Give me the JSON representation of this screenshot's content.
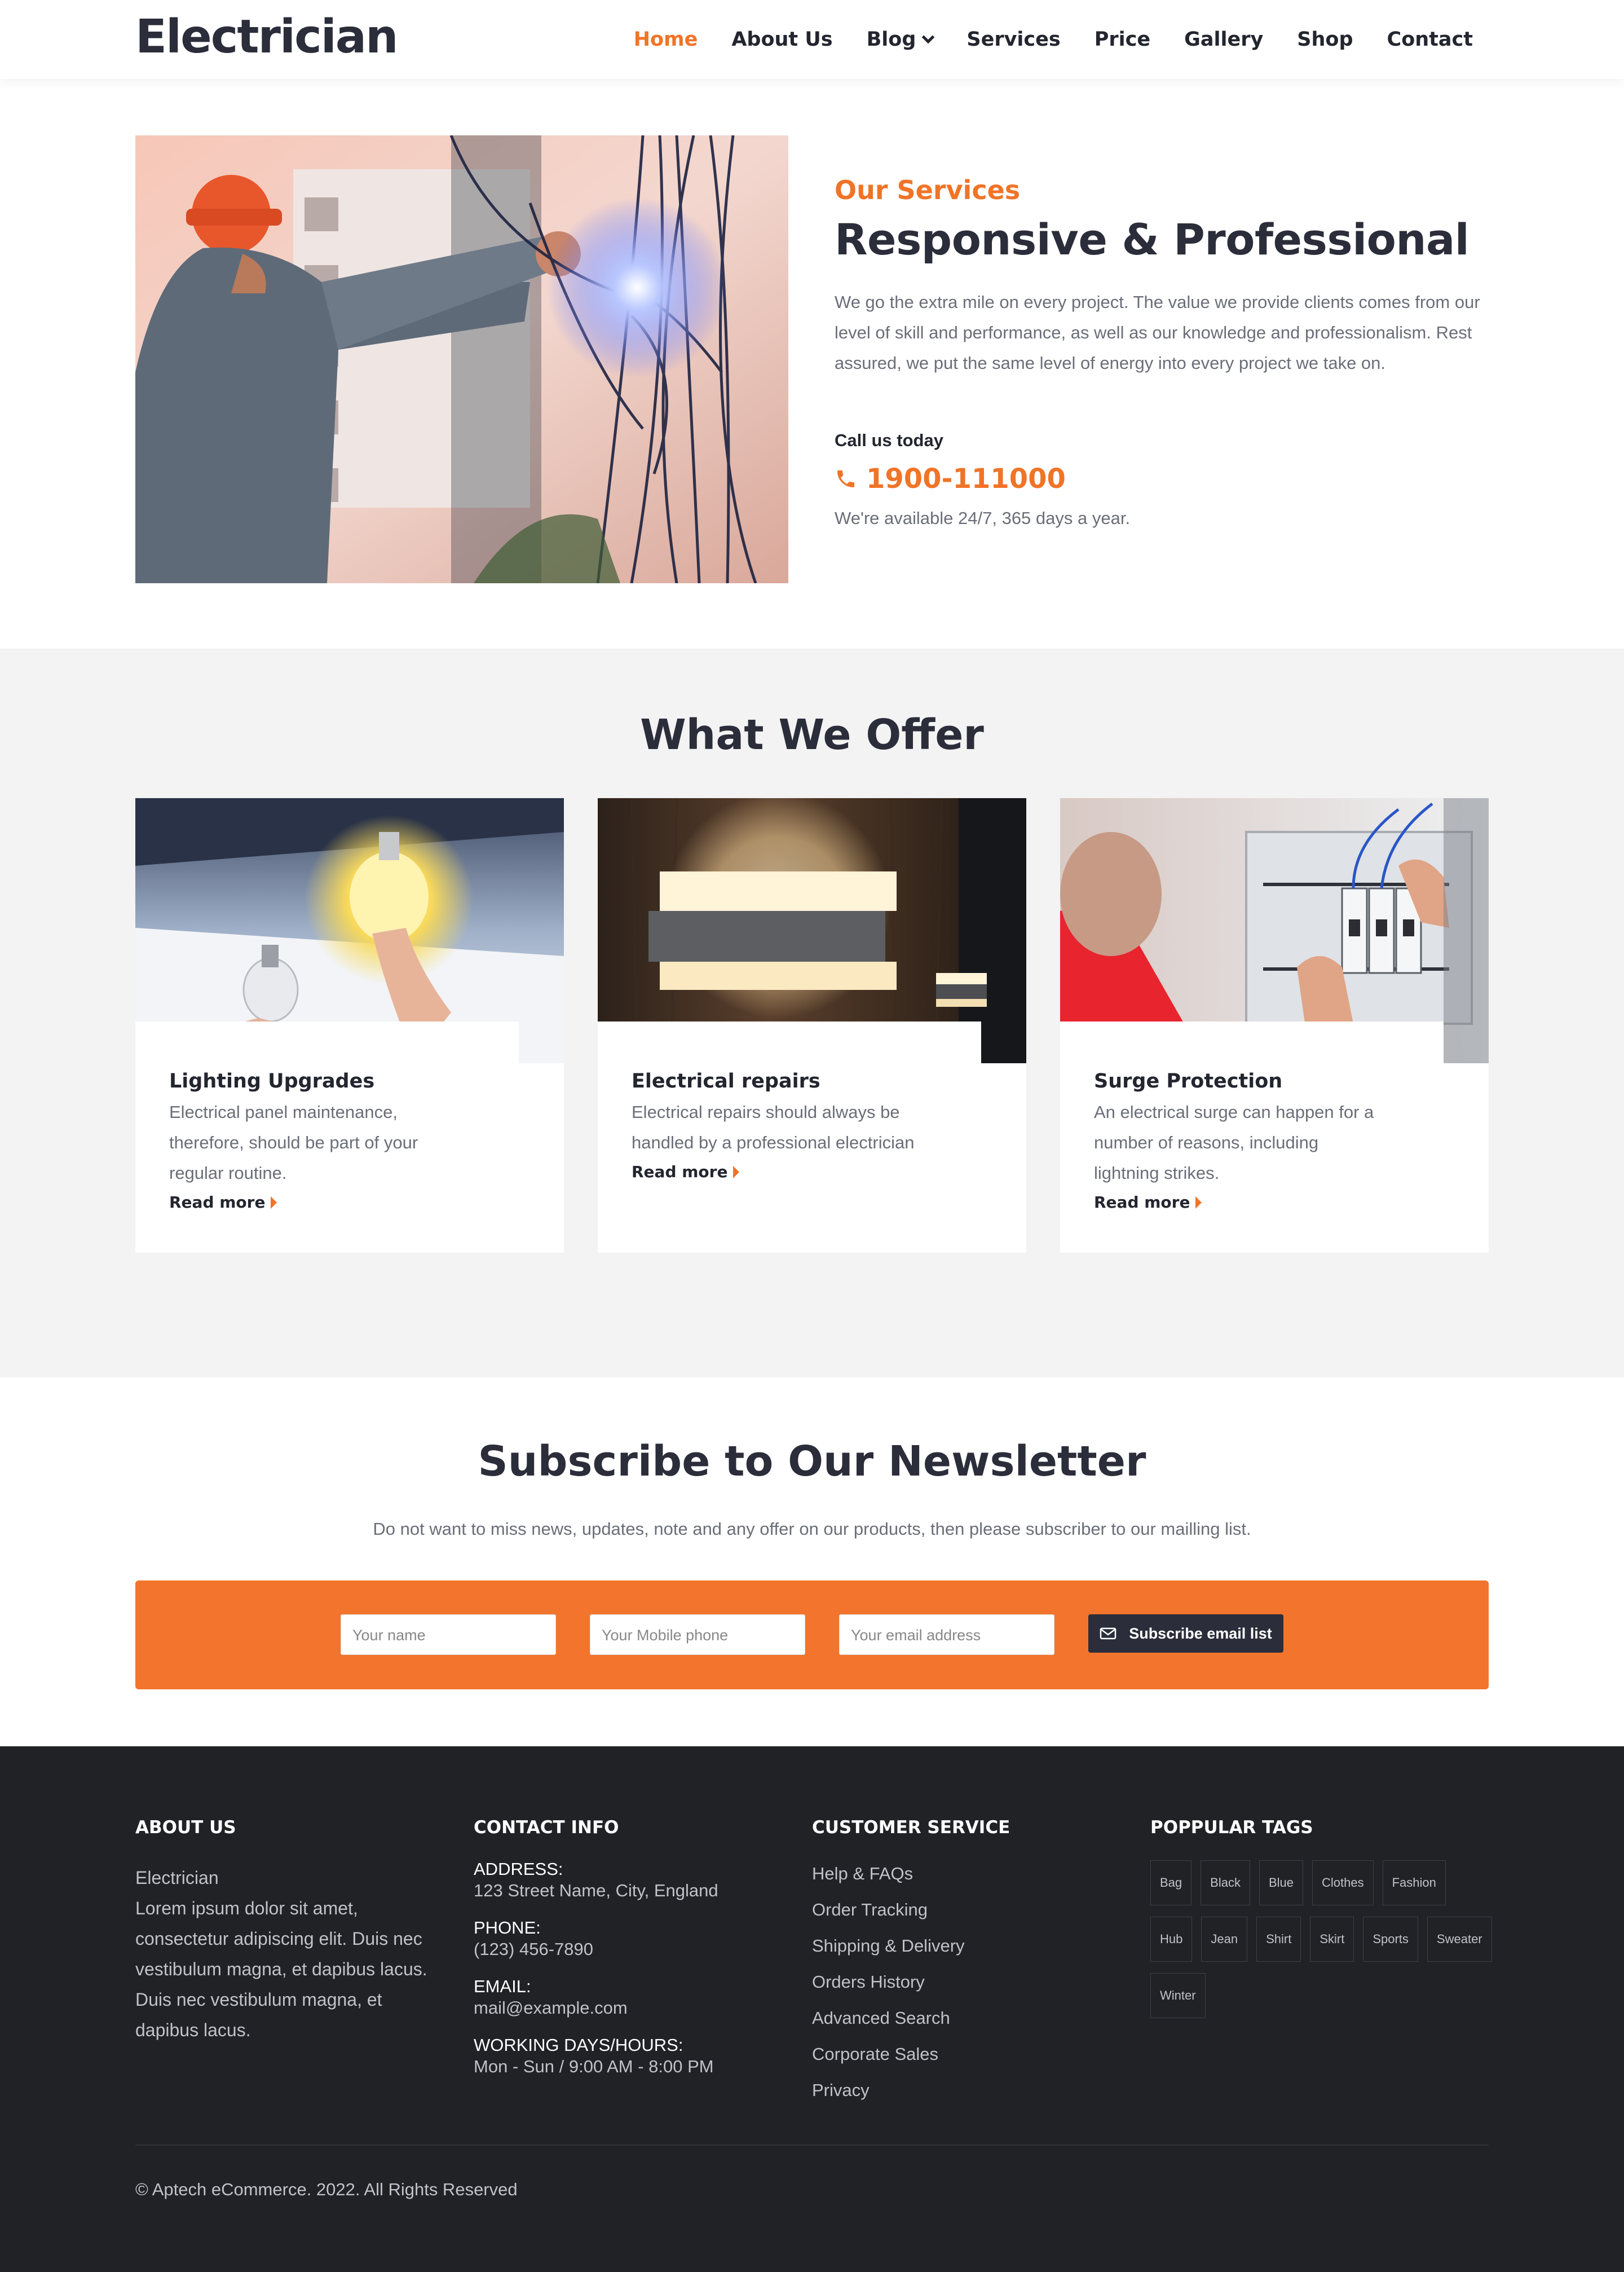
{
  "header": {
    "logo": "Electrician",
    "nav": [
      {
        "label": "Home",
        "active": true
      },
      {
        "label": "About Us"
      },
      {
        "label": "Blog",
        "dropdown": true
      },
      {
        "label": "Services"
      },
      {
        "label": "Price"
      },
      {
        "label": "Gallery"
      },
      {
        "label": "Shop"
      },
      {
        "label": "Contact"
      }
    ]
  },
  "hero": {
    "eyebrow": "Our Services",
    "title": "Responsive & Professional",
    "description": "We go the extra mile on every project. The value we provide clients comes from our level of skill and performance, as well as our knowledge and professionalism. Rest assured, we put the same level of energy into every project we take on.",
    "call_label": "Call us today",
    "phone": "1900-111000",
    "availability": "We're available 24/7, 365 days a year.",
    "image_icon": "electrician-photo"
  },
  "offer": {
    "title": "What We Offer",
    "cards": [
      {
        "title": "Lighting Upgrades",
        "description": "Electrical panel maintenance, therefore, should be part of your regular routine.",
        "read_more": "Read more"
      },
      {
        "title": "Electrical repairs",
        "description": "Electrical repairs should always be handled by a professional electrician",
        "read_more": "Read more"
      },
      {
        "title": "Surge Protection",
        "description": "An electrical surge can happen for a number of reasons, including lightning strikes.",
        "read_more": "Read more"
      }
    ]
  },
  "newsletter": {
    "title": "Subscribe to Our Newsletter",
    "description": "Do not want to miss news, updates, note and any offer on our products, then please subscriber to our mailling list.",
    "name_placeholder": "Your name",
    "phone_placeholder": "Your Mobile phone",
    "email_placeholder": "Your email address",
    "button_label": "Subscribe email list"
  },
  "footer": {
    "about": {
      "heading": "ABOUT US",
      "name": "Electrician",
      "text": "Lorem ipsum dolor sit amet, consectetur adipiscing elit. Duis nec vestibulum magna, et dapibus lacus. Duis nec vestibulum magna, et dapibus lacus."
    },
    "contact": {
      "heading": "CONTACT INFO",
      "address_label": "ADDRESS:",
      "address": "123 Street Name, City, England",
      "phone_label": "PHONE:",
      "phone": "(123) 456-7890",
      "email_label": "EMAIL:",
      "email": "mail@example.com",
      "hours_label": "WORKING DAYS/HOURS:",
      "hours": "Mon - Sun / 9:00 AM - 8:00 PM"
    },
    "service": {
      "heading": "CUSTOMER SERVICE",
      "links": [
        "Help & FAQs",
        "Order Tracking",
        "Shipping & Delivery",
        "Orders History",
        "Advanced Search",
        "Corporate Sales",
        "Privacy"
      ]
    },
    "tags": {
      "heading": "POPPULAR TAGS",
      "items": [
        "Bag",
        "Black",
        "Blue",
        "Clothes",
        "Fashion",
        "Hub",
        "Jean",
        "Shirt",
        "Skirt",
        "Sports",
        "Sweater",
        "Winter"
      ]
    },
    "copyright": "© Aptech eCommerce. 2022. All Rights Reserved"
  },
  "colors": {
    "accent": "#f07428",
    "dark": "#2b2d3a",
    "footer_bg": "#202226"
  }
}
